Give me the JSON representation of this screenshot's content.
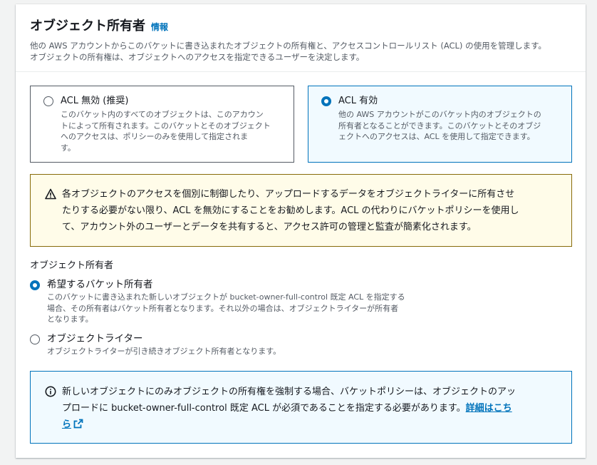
{
  "header": {
    "title": "オブジェクト所有者",
    "info_link": "情報",
    "description_lines": [
      "他の AWS アカウントからこのバケットに書き込まれたオブジェクトの所有権と、アクセスコントロールリスト (ACL) の使用を管理します。",
      "オブジェクトの所有権は、オブジェクトへのアクセスを指定できるユーザーを決定します。"
    ]
  },
  "acl_tiles": [
    {
      "label": "ACL 無効 (推奨)",
      "selected": false,
      "description_lines": [
        "このバケット内のすべてのオブジェクトは、このアカウン",
        "トによって所有されます。このバケットとそのオブジェクト",
        "へのアクセスは、ポリシーのみを使用して指定されま",
        "す。"
      ]
    },
    {
      "label": "ACL 有効",
      "selected": true,
      "description_lines": [
        "他の AWS アカウントがこのバケット内のオブジェクトの",
        "所有者となることができます。このバケットとそのオブジ",
        "ェクトへのアクセスは、ACL を使用して指定できます。"
      ]
    }
  ],
  "warning": {
    "icon": "warning-triangle-icon",
    "lines": [
      "各オブジェクトのアクセスを個別に制御したり、アップロードするデータをオブジェクトライターに所有させ",
      "たりする必要がない限り、ACL を無効にすることをお勧めします。ACL の代わりにバケットポリシーを使用し",
      "て、アカウント外のユーザーとデータを共有すると、アクセス許可の管理と監査が簡素化されます。"
    ]
  },
  "ownership": {
    "label": "オブジェクト所有者",
    "options": [
      {
        "title": "希望するバケット所有者",
        "selected": true,
        "description_lines": [
          "このバケットに書き込まれた新しいオブジェクトが bucket-owner-full-control 既定 ACL を指定する",
          "場合、その所有者はバケット所有者となります。それ以外の場合は、オブジェクトライターが所有者",
          "となります。"
        ]
      },
      {
        "title": "オブジェクトライター",
        "selected": false,
        "description_lines": [
          "オブジェクトライターが引き続きオブジェクト所有者となります。"
        ]
      }
    ]
  },
  "info_box": {
    "icon": "info-circle-icon",
    "line1": "新しいオブジェクトにのみオブジェクトの所有権を強制する場合、バケットポリシーは、オブジェクトのアッ",
    "line2_prefix": "プロードに bucket-owner-full-control 既定 ACL が必須であることを指定する必要があります。",
    "link_part1": "詳細はこち",
    "link_part2": "ら",
    "link_icon": "external-link-icon"
  },
  "colors": {
    "accent": "#0073bb",
    "warning_border": "#876b09",
    "warning_bg": "#fffce9",
    "info_bg": "#f1faff"
  }
}
